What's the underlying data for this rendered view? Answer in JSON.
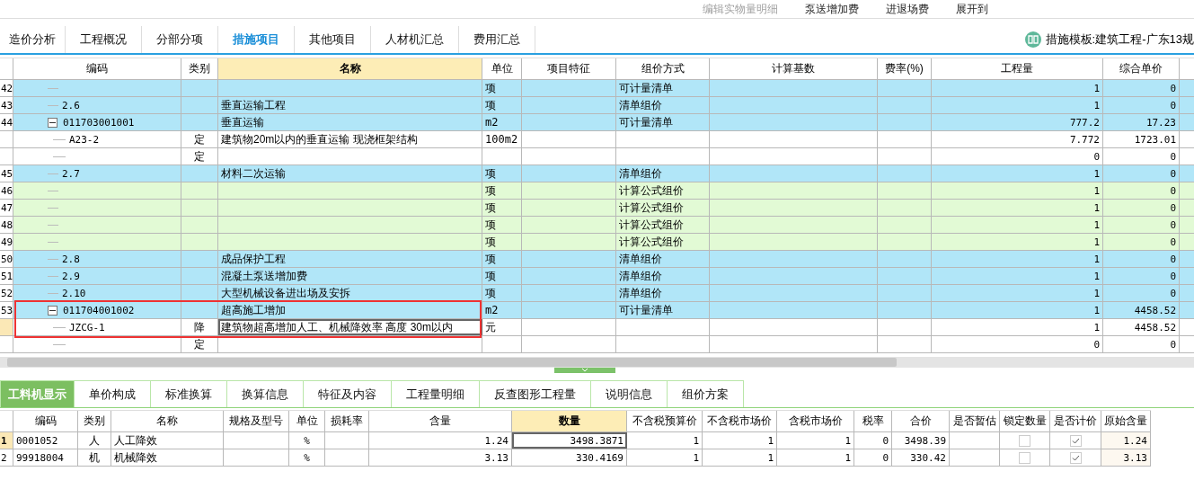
{
  "toolbar": [
    {
      "label": "编辑实物量明细",
      "disabled": true
    },
    {
      "label": "泵送增加费",
      "disabled": false
    },
    {
      "label": "进退场费",
      "disabled": false
    },
    {
      "label": "展开到",
      "disabled": false
    }
  ],
  "tabs": [
    {
      "label": "造价分析",
      "selected": false
    },
    {
      "label": "工程概况",
      "selected": false
    },
    {
      "label": "分部分项",
      "selected": false
    },
    {
      "label": "措施项目",
      "selected": true
    },
    {
      "label": "其他项目",
      "selected": false
    },
    {
      "label": "人材机汇总",
      "selected": false
    },
    {
      "label": "费用汇总",
      "selected": false
    }
  ],
  "template": "措施模板:建筑工程-广东13规",
  "table": {
    "columns": [
      {
        "label": "编码",
        "active": false
      },
      {
        "label": "类别",
        "active": false
      },
      {
        "label": "名称",
        "active": true
      },
      {
        "label": "单位",
        "active": false
      },
      {
        "label": "项目特征",
        "active": false
      },
      {
        "label": "组价方式",
        "active": false
      },
      {
        "label": "计算基数",
        "active": false
      },
      {
        "label": "费率(%)",
        "active": false
      },
      {
        "label": "工程量",
        "active": false
      },
      {
        "label": "综合单价",
        "active": false
      }
    ],
    "rows": [
      {
        "num": "42",
        "kind": "bill",
        "unit": "项",
        "method": "可计量清单",
        "qty": "1",
        "price": "0",
        "selected": false
      },
      {
        "num": "43",
        "kind": "bill",
        "code": "2.6",
        "name": "垂直运输工程",
        "unit": "项",
        "method": "清单组价",
        "qty": "1",
        "price": "0",
        "selected": false
      },
      {
        "num": "44",
        "kind": "bill",
        "code": "011703001001",
        "name": "垂直运输",
        "unit": "m2",
        "method": "可计量清单",
        "qty": "777.2",
        "price": "17.23",
        "selected": false,
        "expanded": true,
        "children": [
          {
            "kind": "item",
            "code": "A23-2",
            "type": "定",
            "name": "建筑物20m以内的垂直运输 现浇框架结构",
            "unit": "100m2",
            "qty": "7.772",
            "price": "1723.01",
            "selected": false
          },
          {
            "kind": "item",
            "type": "定",
            "qty": "0",
            "price": "0",
            "selected": false
          }
        ]
      },
      {
        "num": "45",
        "kind": "bill",
        "code": "2.7",
        "name": "材料二次运输",
        "unit": "项",
        "method": "清单组价",
        "qty": "1",
        "price": "0",
        "selected": false
      },
      {
        "num": "46",
        "kind": "formula",
        "unit": "项",
        "method": "计算公式组价",
        "qty": "1",
        "price": "0",
        "selected": false
      },
      {
        "num": "47",
        "kind": "formula",
        "unit": "项",
        "method": "计算公式组价",
        "qty": "1",
        "price": "0",
        "selected": false
      },
      {
        "num": "48",
        "kind": "formula",
        "unit": "项",
        "method": "计算公式组价",
        "qty": "1",
        "price": "0",
        "selected": false
      },
      {
        "num": "49",
        "kind": "formula",
        "unit": "项",
        "method": "计算公式组价",
        "qty": "1",
        "price": "0",
        "selected": false
      },
      {
        "num": "50",
        "kind": "bill",
        "code": "2.8",
        "name": "成品保护工程",
        "unit": "项",
        "method": "清单组价",
        "qty": "1",
        "price": "0",
        "selected": false
      },
      {
        "num": "51",
        "kind": "bill",
        "code": "2.9",
        "name": "混凝土泵送增加费",
        "unit": "项",
        "method": "清单组价",
        "qty": "1",
        "price": "0",
        "selected": false
      },
      {
        "num": "52",
        "kind": "bill",
        "code": "2.10",
        "name": "大型机械设备进出场及安拆",
        "unit": "项",
        "method": "清单组价",
        "qty": "1",
        "price": "0",
        "selected": false
      },
      {
        "num": "53",
        "kind": "bill",
        "code": "011704001002",
        "name": "超高施工增加",
        "unit": "m2",
        "method": "可计量清单",
        "qty": "1",
        "price": "4458.52",
        "selected": false,
        "expanded": true,
        "annotated": true,
        "children": [
          {
            "kind": "item",
            "code": "JZCG-1",
            "type": "降",
            "name": "建筑物超高增加人工、机械降效率 高度 30m以内",
            "unit": "元",
            "qty": "1",
            "price": "4458.52",
            "selected": true
          },
          {
            "kind": "item",
            "type": "定",
            "qty": "0",
            "price": "0",
            "selected": false
          }
        ]
      }
    ]
  },
  "detail_tabs": [
    {
      "label": "工料机显示",
      "selected": true
    },
    {
      "label": "单价构成",
      "selected": false
    },
    {
      "label": "标准换算",
      "selected": false
    },
    {
      "label": "换算信息",
      "selected": false
    },
    {
      "label": "特征及内容",
      "selected": false
    },
    {
      "label": "工程量明细",
      "selected": false
    },
    {
      "label": "反查图形工程量",
      "selected": false
    },
    {
      "label": "说明信息",
      "selected": false
    },
    {
      "label": "组价方案",
      "selected": false
    }
  ],
  "detail_table": {
    "columns": [
      {
        "label": "编码",
        "active": false
      },
      {
        "label": "类别",
        "active": false
      },
      {
        "label": "名称",
        "active": false
      },
      {
        "label": "规格及型号",
        "active": false
      },
      {
        "label": "单位",
        "active": false
      },
      {
        "label": "损耗率",
        "active": false
      },
      {
        "label": "含量",
        "active": false
      },
      {
        "label": "数量",
        "active": true
      },
      {
        "label": "不含税预算价",
        "active": false
      },
      {
        "label": "不含税市场价",
        "active": false
      },
      {
        "label": "含税市场价",
        "active": false
      },
      {
        "label": "税率",
        "active": false
      },
      {
        "label": "合价",
        "active": false
      },
      {
        "label": "是否暂估",
        "active": false
      },
      {
        "label": "锁定数量",
        "active": false
      },
      {
        "label": "是否计价",
        "active": false
      },
      {
        "label": "原始含量",
        "active": false
      }
    ],
    "rows": [
      {
        "num": "1",
        "code": "0001052",
        "type": "人",
        "name": "人工降效",
        "unit": "%",
        "content": "1.24",
        "qty": "3498.3871",
        "budget": "1",
        "market": "1",
        "market_tax": "1",
        "tax": "0",
        "total": "3498.39",
        "locked": false,
        "priced": true,
        "original": "1.24",
        "selected": true
      },
      {
        "num": "2",
        "code": "99918004",
        "type": "机",
        "name": "机械降效",
        "unit": "%",
        "content": "3.13",
        "qty": "330.4169",
        "budget": "1",
        "market": "1",
        "market_tax": "1",
        "tax": "0",
        "total": "330.42",
        "locked": false,
        "priced": true,
        "original": "3.13",
        "selected": false
      }
    ]
  }
}
